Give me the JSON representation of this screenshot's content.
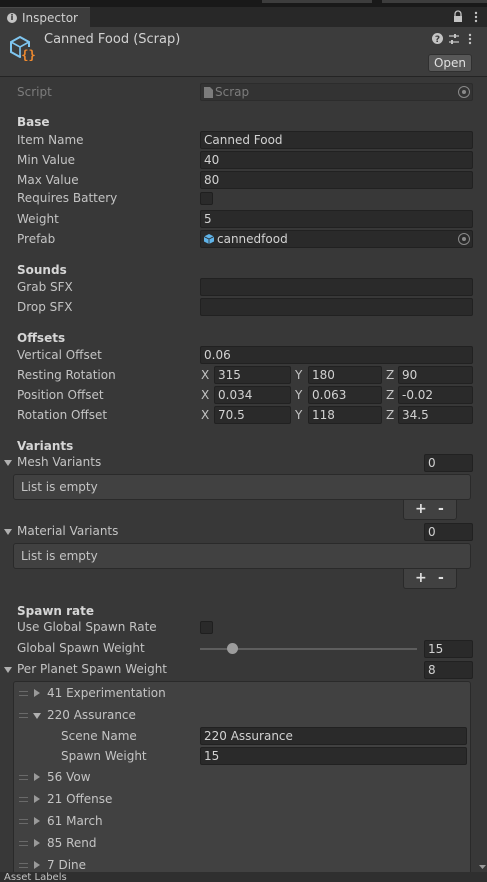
{
  "window": {
    "tab_title": "Inspector"
  },
  "header": {
    "title": "Canned Food (Scrap)",
    "open_label": "Open"
  },
  "script": {
    "label": "Script",
    "value": "Scrap"
  },
  "base": {
    "heading": "Base",
    "item_name": {
      "label": "Item Name",
      "value": "Canned Food"
    },
    "min_value": {
      "label": "Min Value",
      "value": "40"
    },
    "max_value": {
      "label": "Max Value",
      "value": "80"
    },
    "requires_battery": {
      "label": "Requires Battery",
      "checked": false
    },
    "weight": {
      "label": "Weight",
      "value": "5"
    },
    "prefab": {
      "label": "Prefab",
      "value": "cannedfood"
    }
  },
  "sounds": {
    "heading": "Sounds",
    "grab": {
      "label": "Grab SFX",
      "value": ""
    },
    "drop": {
      "label": "Drop SFX",
      "value": ""
    }
  },
  "offsets": {
    "heading": "Offsets",
    "vertical": {
      "label": "Vertical Offset",
      "value": "0.06"
    },
    "resting": {
      "label": "Resting Rotation",
      "x": "315",
      "y": "180",
      "z": "90"
    },
    "position": {
      "label": "Position Offset",
      "x": "0.034",
      "y": "0.063",
      "z": "-0.02"
    },
    "rotation": {
      "label": "Rotation Offset",
      "x": "70.5",
      "y": "118",
      "z": "34.5"
    }
  },
  "axis": {
    "x": "X",
    "y": "Y",
    "z": "Z"
  },
  "variants": {
    "heading": "Variants",
    "mesh": {
      "label": "Mesh Variants",
      "count": "0",
      "empty_text": "List is empty"
    },
    "material": {
      "label": "Material Variants",
      "count": "0",
      "empty_text": "List is empty"
    },
    "add": "+",
    "remove": "-"
  },
  "spawn": {
    "heading": "Spawn rate",
    "use_global": {
      "label": "Use Global Spawn Rate",
      "checked": false
    },
    "global_weight": {
      "label": "Global Spawn Weight",
      "value": "15",
      "slider_fraction": 0.15
    },
    "per_planet": {
      "label": "Per Planet Spawn Weight",
      "count": "8"
    },
    "planets": [
      {
        "name": "41 Experimentation",
        "expanded": false
      },
      {
        "name": "220 Assurance",
        "expanded": true,
        "scene_name_label": "Scene Name",
        "scene_name": "220 Assurance",
        "spawn_weight_label": "Spawn Weight",
        "spawn_weight": "15"
      },
      {
        "name": "56 Vow",
        "expanded": false
      },
      {
        "name": "21 Offense",
        "expanded": false
      },
      {
        "name": "61 March",
        "expanded": false
      },
      {
        "name": "85 Rend",
        "expanded": false
      },
      {
        "name": "7 Dine",
        "expanded": false
      }
    ]
  },
  "footer": {
    "text": "Asset Labels"
  }
}
